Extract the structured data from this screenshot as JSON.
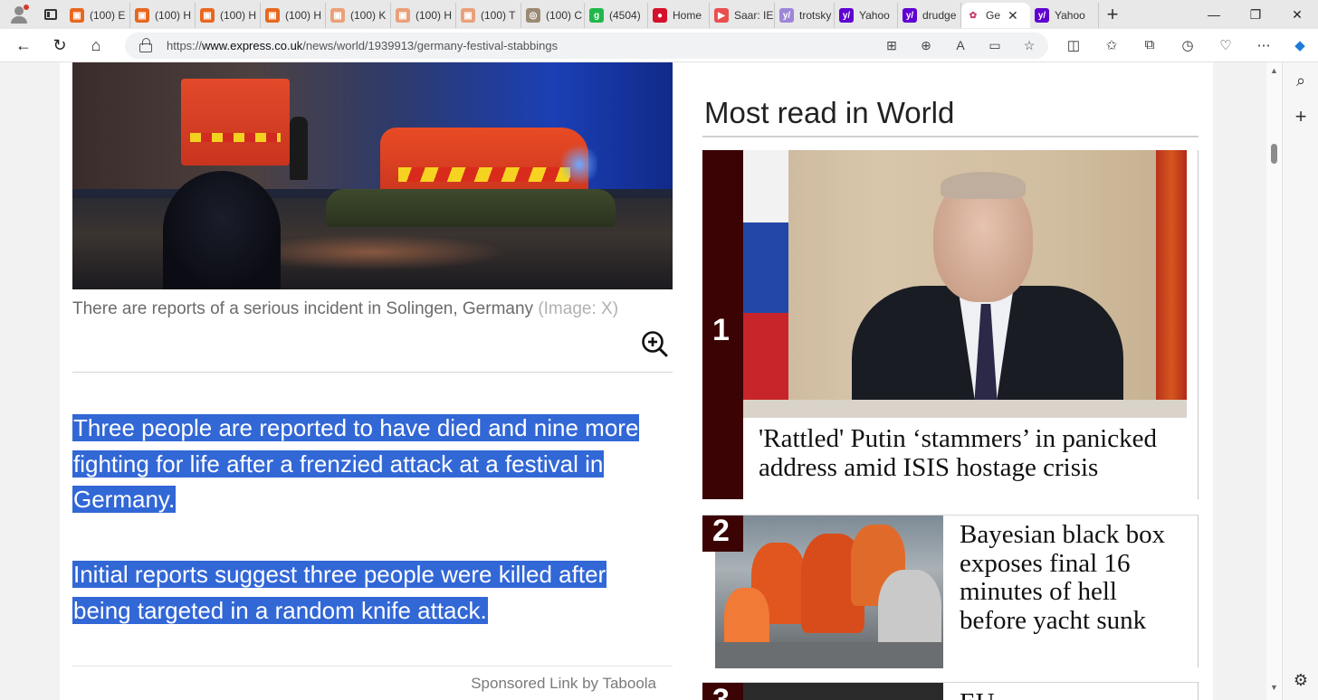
{
  "browser": {
    "tabs": [
      {
        "label": "(100) E",
        "fav_color": "#e8671e",
        "fav_glyph": "▣"
      },
      {
        "label": "(100) H",
        "fav_color": "#e8671e",
        "fav_glyph": "▣"
      },
      {
        "label": "(100) H",
        "fav_color": "#e8671e",
        "fav_glyph": "▣"
      },
      {
        "label": "(100) H",
        "fav_color": "#e8671e",
        "fav_glyph": "▣"
      },
      {
        "label": "(100) K",
        "fav_color": "#e9a07a",
        "fav_glyph": "▣"
      },
      {
        "label": "(100) H",
        "fav_color": "#e9a07a",
        "fav_glyph": "▣"
      },
      {
        "label": "(100) T",
        "fav_color": "#e9a07a",
        "fav_glyph": "▣"
      },
      {
        "label": "(100) C",
        "fav_color": "#9b8a74",
        "fav_glyph": "◎"
      },
      {
        "label": "(4504)",
        "fav_color": "#21b84b",
        "fav_glyph": "g"
      },
      {
        "label": "Home",
        "fav_color": "#d6102a",
        "fav_glyph": "●"
      },
      {
        "label": "Saar: IE",
        "fav_color": "#ea4f4f",
        "fav_glyph": "▶"
      },
      {
        "label": "trotsky",
        "fav_color": "#9d86d8",
        "fav_glyph": "y/"
      },
      {
        "label": "Yahoo",
        "fav_color": "#5f01d1",
        "fav_glyph": "y/"
      },
      {
        "label": "drudge",
        "fav_color": "#5f01d1",
        "fav_glyph": "y/"
      },
      {
        "label": "Ge",
        "fav_color": "#ffffff",
        "fav_glyph": "✿",
        "active": true
      },
      {
        "label": "Yahoo",
        "fav_color": "#5f01d1",
        "fav_glyph": "y/"
      }
    ],
    "url_prefix": "https://",
    "url_domain": "www.express.co.uk",
    "url_path": "/news/world/1939913/germany-festival-stabbings"
  },
  "article": {
    "caption_text": "There are reports of a serious incident in Solingen, Germany",
    "caption_credit": "(Image: X)",
    "paragraph1": "Three people are reported to have died and nine more fighting for life after a frenzied attack at a festival in Germany.",
    "paragraph2": "Initial reports suggest three people were killed after being targeted in a random knife attack.",
    "sponsored": "Sponsored Link by Taboola"
  },
  "most_read": {
    "title": "Most read in World",
    "items": [
      {
        "rank": "1",
        "headline": "'Rattled' Putin ‘stammers’ in panicked address amid ISIS hostage crisis"
      },
      {
        "rank": "2",
        "headline": "Bayesian black box exposes final 16 minutes of hell before yacht sunk"
      },
      {
        "rank": "3",
        "headline": "EU"
      }
    ]
  },
  "colors": {
    "selection": "#3267d6",
    "rank_band": "#3b0303"
  }
}
